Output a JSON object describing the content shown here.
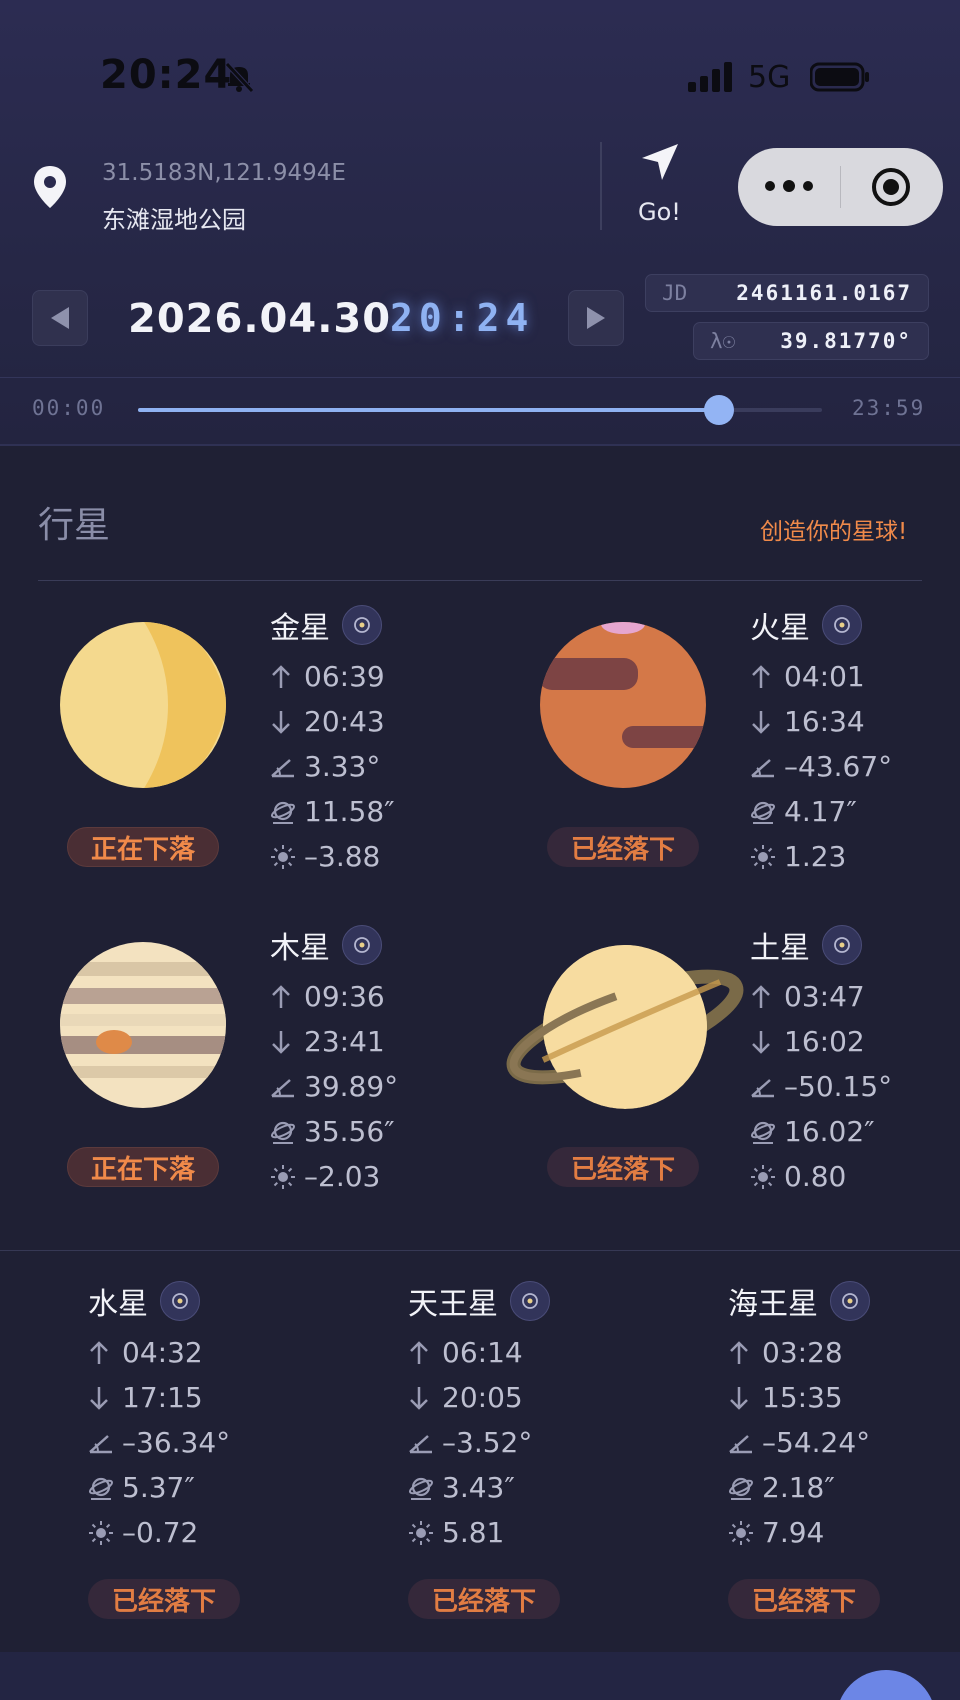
{
  "status_bar": {
    "time": "20:24",
    "network": "5G"
  },
  "location": {
    "coords": "31.5183N,121.9494E",
    "name": "东滩湿地公园",
    "go_label": "Go!"
  },
  "datetime": {
    "date": "2026.04.30",
    "time": "20:24",
    "jd_key": "JD",
    "jd_value": "2461161.0167",
    "lambda_key": "λ☉",
    "lambda_value": "39.81770°"
  },
  "slider": {
    "start": "00:00",
    "end": "23:59",
    "position_fraction": 0.85
  },
  "section": {
    "title": "行星",
    "create_link": "创造你的星球!"
  },
  "planets": [
    {
      "name": "金星",
      "rise": "06:39",
      "set": "20:43",
      "altitude": "3.33°",
      "diameter": "11.58″",
      "magnitude": "–3.88",
      "status": "正在下落"
    },
    {
      "name": "火星",
      "rise": "04:01",
      "set": "16:34",
      "altitude": "–43.67°",
      "diameter": "4.17″",
      "magnitude": "1.23",
      "status": "已经落下"
    },
    {
      "name": "木星",
      "rise": "09:36",
      "set": "23:41",
      "altitude": "39.89°",
      "diameter": "35.56″",
      "magnitude": "–2.03",
      "status": "正在下落"
    },
    {
      "name": "土星",
      "rise": "03:47",
      "set": "16:02",
      "altitude": "–50.15°",
      "diameter": "16.02″",
      "magnitude": "0.80",
      "status": "已经落下"
    },
    {
      "name": "水星",
      "rise": "04:32",
      "set": "17:15",
      "altitude": "–36.34°",
      "diameter": "5.37″",
      "magnitude": "–0.72",
      "status": "已经落下"
    },
    {
      "name": "天王星",
      "rise": "06:14",
      "set": "20:05",
      "altitude": "–3.52°",
      "diameter": "3.43″",
      "magnitude": "5.81",
      "status": "已经落下"
    },
    {
      "name": "海王星",
      "rise": "03:28",
      "set": "15:35",
      "altitude": "–54.24°",
      "diameter": "2.18″",
      "magnitude": "7.94",
      "status": "已经落下"
    }
  ],
  "icons": {
    "location": "map-pin-icon",
    "go": "navigation-arrow-icon",
    "more": "more-dots-icon",
    "close": "target-circle-icon",
    "prev": "triangle-left-icon",
    "next": "triangle-right-icon",
    "rise": "arrow-up-icon",
    "set": "arrow-down-icon",
    "altitude": "angle-icon",
    "diameter": "planet-ring-icon",
    "magnitude": "sun-icon",
    "locate_planet": "target-icon"
  },
  "colors": {
    "accent_blue": "#8fb2f2",
    "accent_orange": "#f08a4a",
    "background": "#1f2034"
  }
}
